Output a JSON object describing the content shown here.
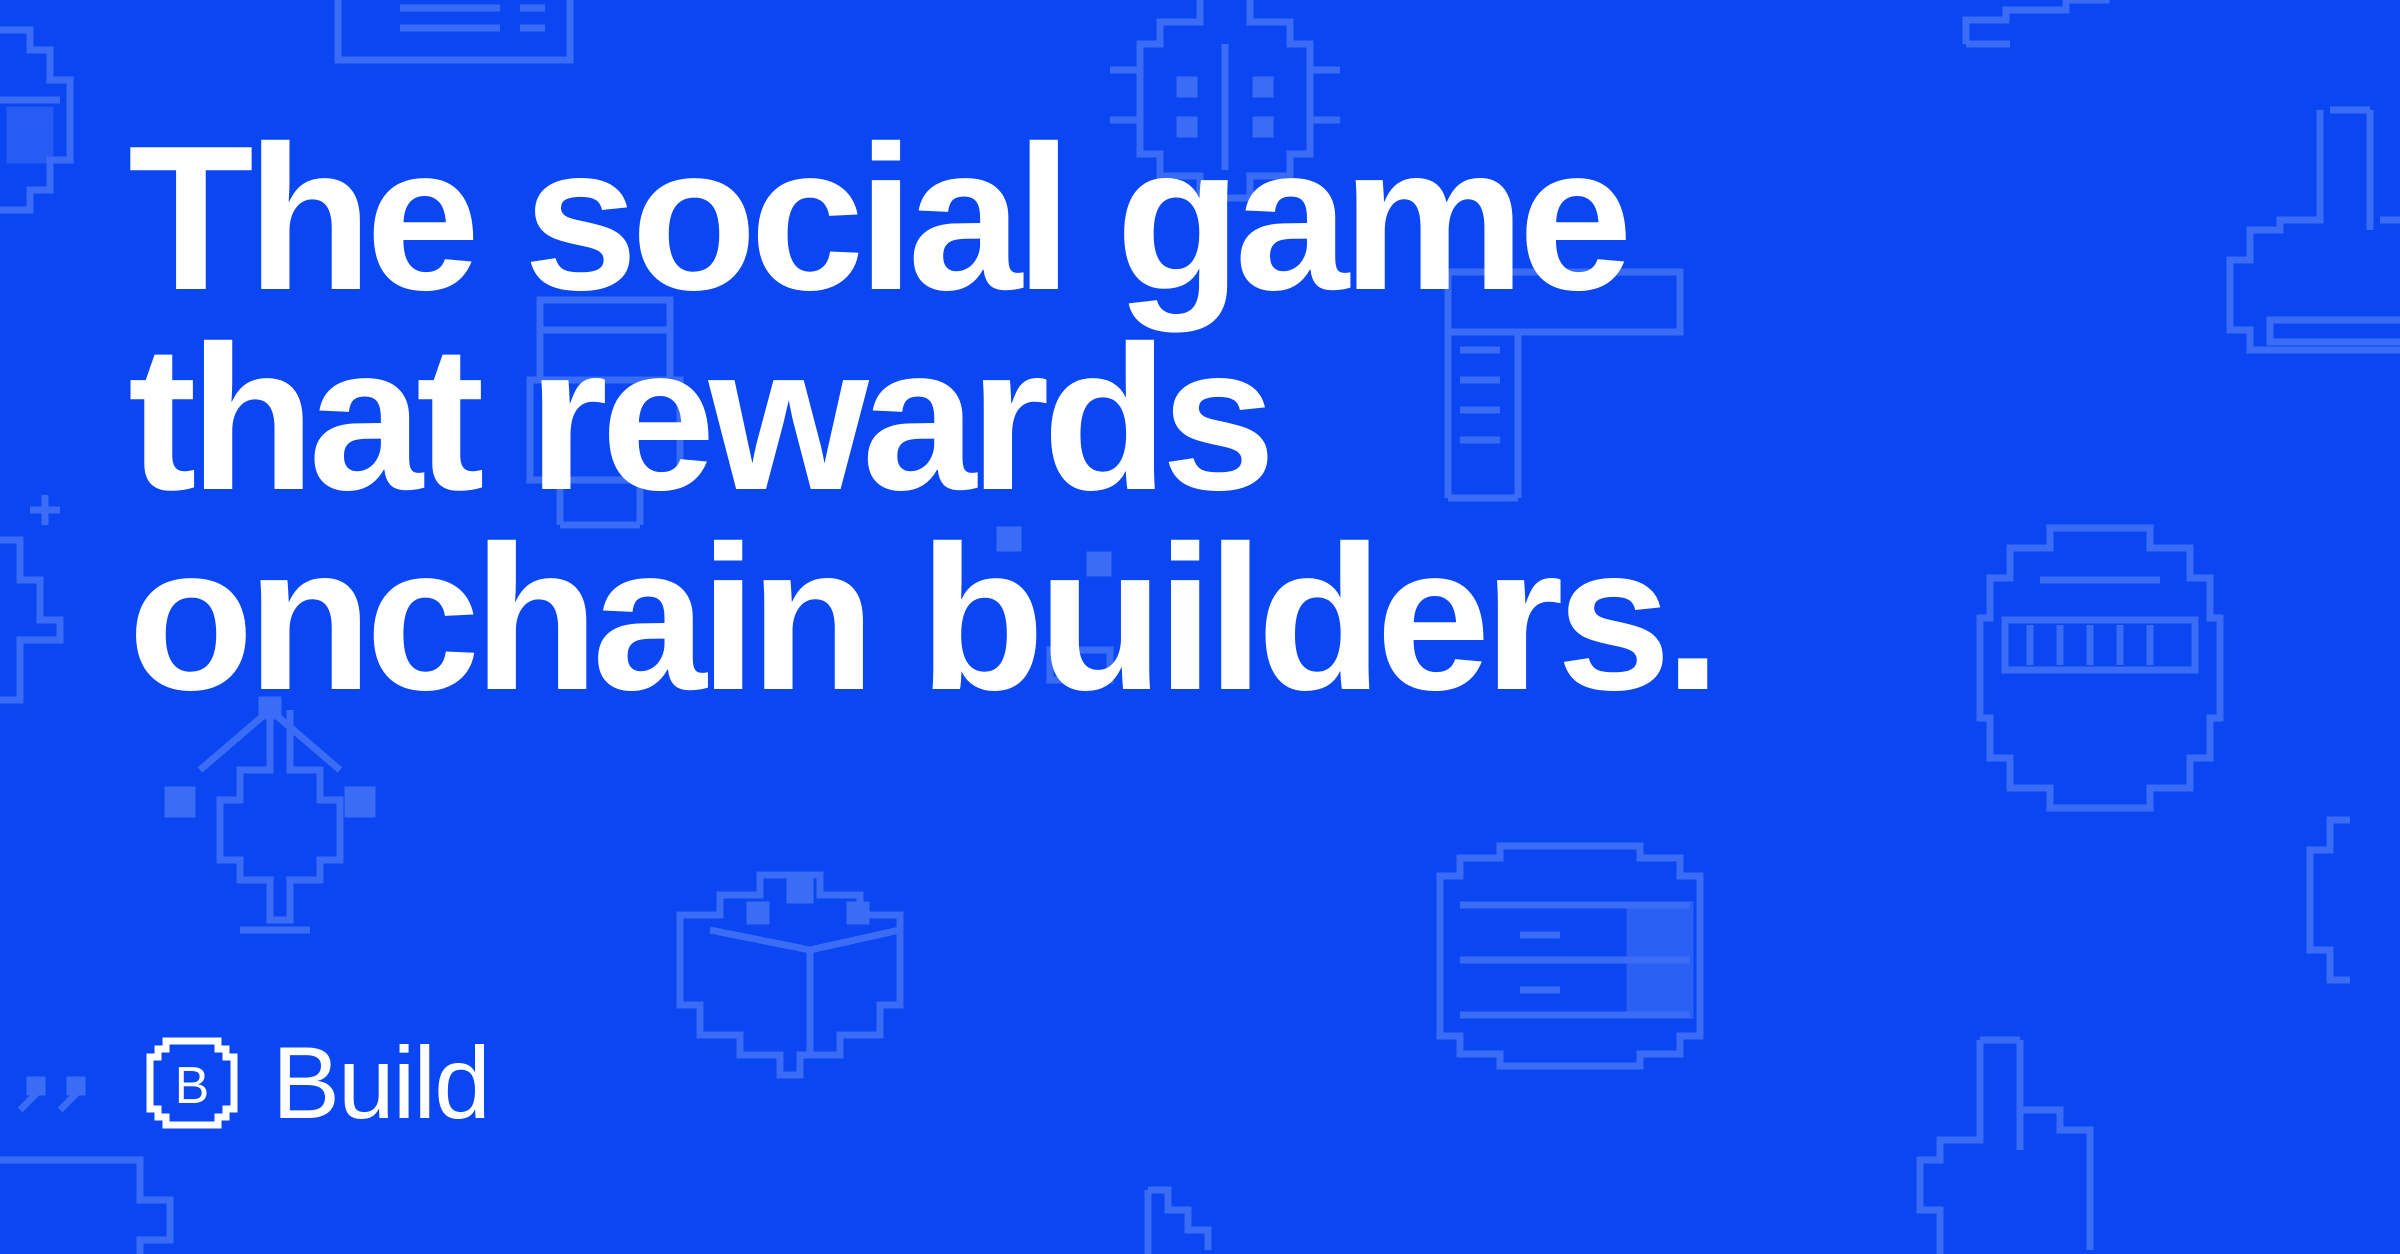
{
  "headline": {
    "line1": "The social game",
    "line2": "that rewards",
    "line3": "onchain builders."
  },
  "brand": {
    "logo_letter": "B",
    "name": "Build"
  },
  "colors": {
    "background": "#0a46f2",
    "pattern": "#3a6cf6",
    "text": "#ffffff"
  },
  "icons": [
    "keyboard-icon",
    "bug-icon",
    "pencil-icon",
    "basketball-icon",
    "hand-pointer-icon",
    "layout-icon",
    "cake-icon",
    "helmet-icon",
    "pen-nib-icon",
    "cube-icon",
    "database-icon",
    "coffee-mug-icon",
    "cursor-icon"
  ]
}
